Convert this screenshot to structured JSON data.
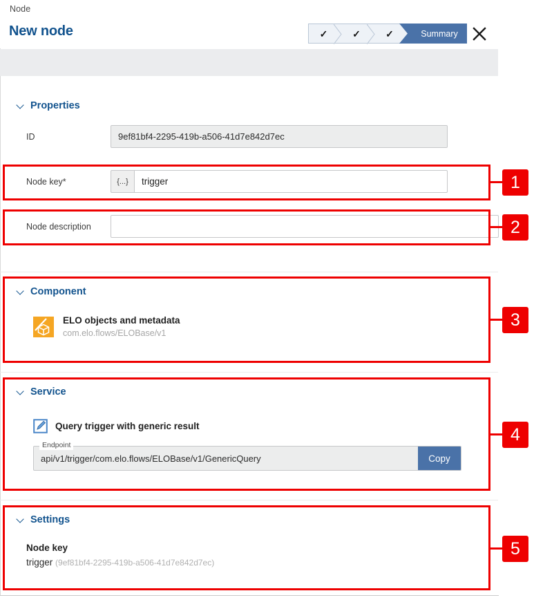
{
  "header": {
    "breadcrumb": "Node",
    "title": "New node",
    "close_label": "✕",
    "wizard": {
      "steps": [
        {
          "label": "✓",
          "state": "done"
        },
        {
          "label": "✓",
          "state": "done"
        },
        {
          "label": "✓",
          "state": "done"
        },
        {
          "label": "Summary",
          "state": "current"
        }
      ]
    }
  },
  "sections": {
    "properties": {
      "heading": "Properties",
      "id_label": "ID",
      "id_value": "9ef81bf4-2295-419b-a506-41d7e842d7ec",
      "node_key_label": "Node key*",
      "node_key_prefix": "{...}",
      "node_key_value": "trigger",
      "node_key_placeholder": "",
      "node_description_label": "Node description",
      "node_description_value": "",
      "node_description_placeholder": ""
    },
    "component": {
      "heading": "Component",
      "name": "ELO objects and metadata",
      "identifier": "com.elo.flows/ELOBase/v1",
      "icon": "elo-cube-icon"
    },
    "service": {
      "heading": "Service",
      "name": "Query trigger with generic result",
      "icon": "edit-square-icon",
      "endpoint_label": "Endpoint",
      "endpoint_value": "api/v1/trigger/com.elo.flows/ELOBase/v1/GenericQuery",
      "copy_label": "Copy"
    },
    "settings": {
      "heading": "Settings",
      "node_key_title": "Node key",
      "node_key_value": "trigger",
      "node_key_id": "(9ef81bf4-2295-419b-a506-41d7e842d7ec)"
    }
  },
  "annotations": {
    "badges": [
      {
        "number": "1"
      },
      {
        "number": "2"
      },
      {
        "number": "3"
      },
      {
        "number": "4"
      },
      {
        "number": "5"
      }
    ]
  },
  "colors": {
    "accent_blue": "#12538e",
    "step_blue": "#4a72a8",
    "callout_red": "#ee0000",
    "component_orange": "#f5a623",
    "toolbar_gray": "#ebecee"
  }
}
